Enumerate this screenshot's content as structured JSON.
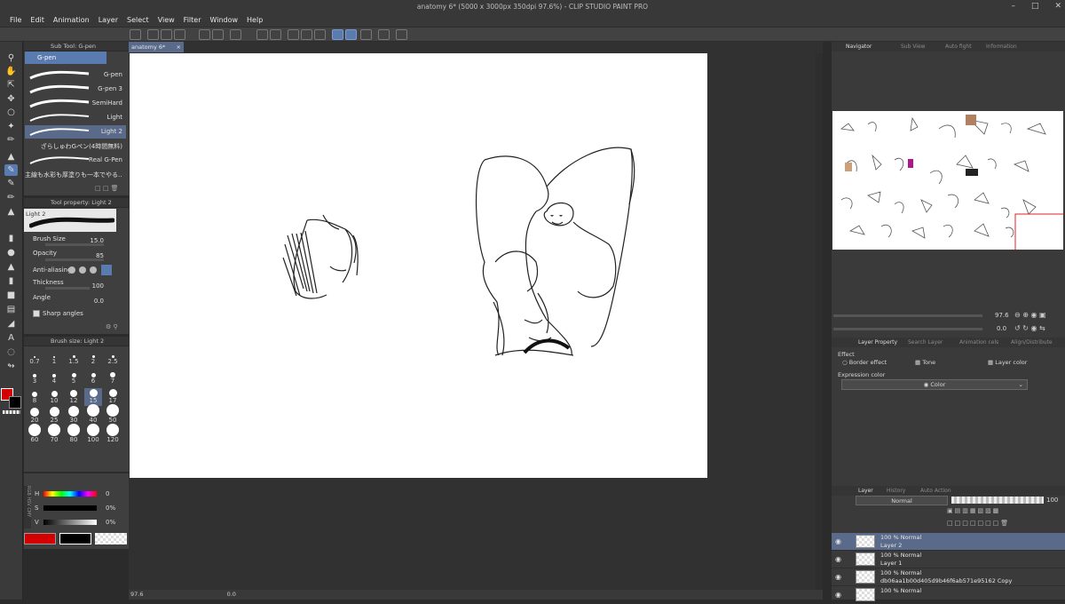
{
  "window": {
    "title": "anatomy 6* (5000 x 3000px 350dpi 97.6%) - CLIP STUDIO PAINT PRO"
  },
  "menu": [
    "File",
    "Edit",
    "Animation",
    "Layer",
    "Select",
    "View",
    "Filter",
    "Window",
    "Help"
  ],
  "subtool": {
    "header": "Sub Tool: G-pen",
    "group": "G-pen",
    "brushes": [
      "G-pen",
      "G-pen 3",
      "SemiHard",
      "Light",
      "Light 2",
      "ざらしゅわGペン(4時間無料)",
      "Real G-Pen",
      "主線も水彩も厚塗りも一本でやる..."
    ],
    "selected_index": 4
  },
  "toolprop": {
    "header": "Tool property: Light 2",
    "preview_label": "Light 2",
    "brush_size_label": "Brush Size",
    "brush_size": "15.0",
    "opacity_label": "Opacity",
    "opacity": "85",
    "antialias_label": "Anti-aliasing",
    "thickness_label": "Thickness",
    "thickness": "100",
    "angle_label": "Angle",
    "angle": "0.0",
    "sharp_label": "Sharp angles"
  },
  "brushsize": {
    "header": "Brush size: Light 2",
    "values": [
      "0.7",
      "1",
      "1.5",
      "2",
      "2.5",
      "3",
      "4",
      "5",
      "6",
      "7",
      "8",
      "10",
      "12",
      "15",
      "17",
      "20",
      "25",
      "30",
      "40",
      "50",
      "60",
      "70",
      "80",
      "100",
      "120"
    ],
    "selected": "15"
  },
  "color": {
    "h_label": "H",
    "h": "0",
    "s_label": "S",
    "s": "0%",
    "v_label": "V",
    "v": "0%",
    "side": [
      "RGB",
      "HSV",
      "CMY"
    ],
    "main": "#d40000",
    "sub": "#000000"
  },
  "doc_tab": "anatomy 6*",
  "status": {
    "zoom": "97.6",
    "angle": "0.0"
  },
  "navigator": {
    "tabs": [
      "Navigator",
      "Sub View",
      "Auto fight",
      "Information"
    ],
    "zoom": "97.6",
    "angle": "0.0"
  },
  "layer_property": {
    "tabs": [
      "Layer Property",
      "Search Layer",
      "Animation cels",
      "Align/Distribute"
    ],
    "effect_label": "Effect",
    "border_effect": "Border effect",
    "tone": "Tone",
    "layer_color": "Layer color",
    "expression_label": "Expression color",
    "expression_value": "Color"
  },
  "layer_panel": {
    "tabs": [
      "Layer",
      "History",
      "Auto Action"
    ],
    "blend": "Normal",
    "opacity": "100",
    "layers": [
      {
        "line1": "100 % Normal",
        "line2": "Layer 2",
        "selected": true
      },
      {
        "line1": "100 % Normal",
        "line2": "Layer 1",
        "selected": false
      },
      {
        "line1": "100 % Normal",
        "line2": "db06aa1b00d405d9b46f6ab571e95162 Copy",
        "selected": false
      },
      {
        "line1": "100 % Normal",
        "line2": "",
        "selected": false
      }
    ]
  },
  "colors": {
    "accent": "#5a7bb0",
    "selected_row": "#5a6a8a",
    "canvas_bg": "#313131",
    "paper": "#ffffff"
  }
}
